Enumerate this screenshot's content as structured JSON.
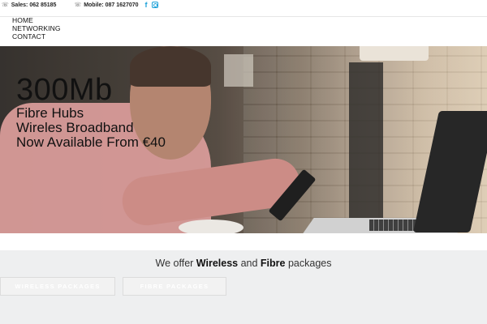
{
  "topbar": {
    "sales_label": "Sales: 062 85185",
    "mobile_label": "Mobile: 087 1627070",
    "phone_glyph": "☏",
    "social_icons": [
      "facebook-icon",
      "instagram-icon"
    ],
    "facebook_glyph": "f"
  },
  "nav": {
    "items": [
      {
        "label": "HOME"
      },
      {
        "label": "NETWORKING"
      },
      {
        "label": "CONTACT"
      }
    ]
  },
  "hero": {
    "headline": "300Mb",
    "line1": "Fibre Hubs",
    "line2": "Wireles Broadband",
    "line3": "Now Available From €40"
  },
  "offer": {
    "prefix": "We offer ",
    "wireless": "Wireless",
    "middle": " and ",
    "fibre": "Fibre",
    "suffix": " packages",
    "buttons": {
      "wireless_label": "WIRELESS PACKAGES",
      "fibre_label": "FIBRE PACKAGES"
    }
  },
  "colors": {
    "accent": "#1aa0d8",
    "offer_bg": "#eeeff0"
  }
}
